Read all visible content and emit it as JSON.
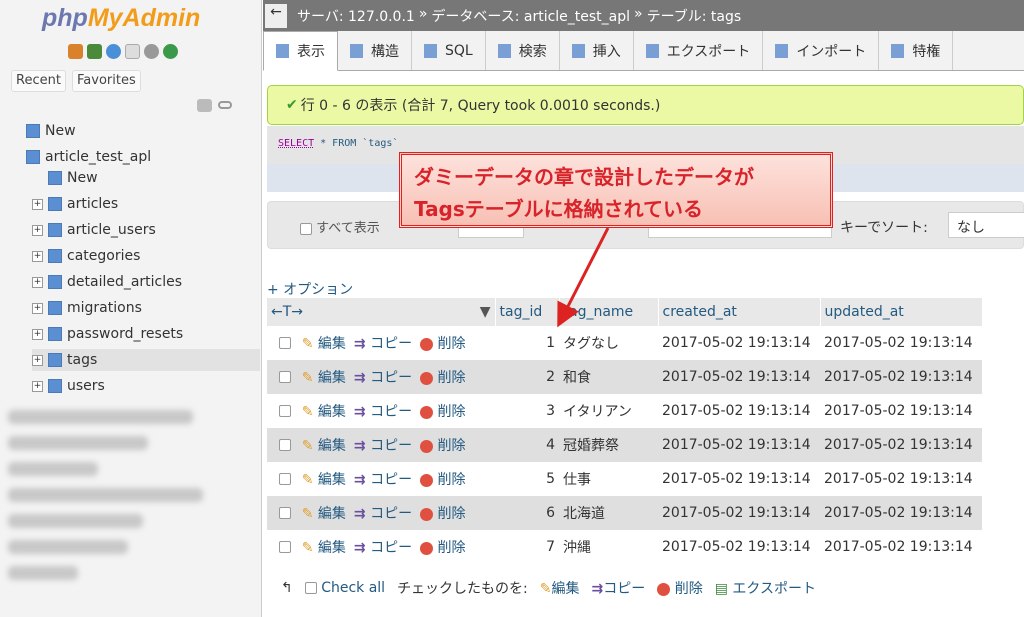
{
  "sidebar": {
    "logo_php": "php",
    "logo_myadmin": "MyAdmin",
    "recent": "Recent",
    "favorites": "Favorites",
    "tree": [
      {
        "label": "New",
        "level": 0
      },
      {
        "label": "article_test_apl",
        "level": 0
      },
      {
        "label": "New",
        "level": 1
      },
      {
        "label": "articles",
        "level": 1
      },
      {
        "label": "article_users",
        "level": 1
      },
      {
        "label": "categories",
        "level": 1
      },
      {
        "label": "detailed_articles",
        "level": 1
      },
      {
        "label": "migrations",
        "level": 1
      },
      {
        "label": "password_resets",
        "level": 1
      },
      {
        "label": "tags",
        "level": 1,
        "selected": true
      },
      {
        "label": "users",
        "level": 1
      }
    ]
  },
  "breadcrumb": {
    "back": "←",
    "server": "サーバ: 127.0.0.1",
    "sep": "»",
    "database": "データベース: article_test_apl",
    "table": "テーブル: tags"
  },
  "tabs": [
    "表示",
    "構造",
    "SQL",
    "検索",
    "挿入",
    "エクスポート",
    "インポート",
    "特権"
  ],
  "message": "行 0 - 6 の表示 (合計 7, Query took 0.0010 seconds.)",
  "query": {
    "k1": "SELECT",
    "rest": " * FROM `tags`"
  },
  "filter": {
    "show_all": "すべて表示",
    "sort_label": "キーでソート:",
    "sort_value": "なし"
  },
  "options": "+ オプション",
  "table": {
    "nav": "←T→",
    "columns": [
      "tag_id",
      "tag_name",
      "created_at",
      "updated_at"
    ],
    "actions": {
      "edit": "編集",
      "copy": "コピー",
      "delete": "削除"
    },
    "rows": [
      [
        "1",
        "タグなし",
        "2017-05-02 19:13:14",
        "2017-05-02 19:13:14"
      ],
      [
        "2",
        "和食",
        "2017-05-02 19:13:14",
        "2017-05-02 19:13:14"
      ],
      [
        "3",
        "イタリアン",
        "2017-05-02 19:13:14",
        "2017-05-02 19:13:14"
      ],
      [
        "4",
        "冠婚葬祭",
        "2017-05-02 19:13:14",
        "2017-05-02 19:13:14"
      ],
      [
        "5",
        "仕事",
        "2017-05-02 19:13:14",
        "2017-05-02 19:13:14"
      ],
      [
        "6",
        "北海道",
        "2017-05-02 19:13:14",
        "2017-05-02 19:13:14"
      ],
      [
        "7",
        "沖縄",
        "2017-05-02 19:13:14",
        "2017-05-02 19:13:14"
      ]
    ]
  },
  "footer": {
    "check_all": "Check all",
    "with_selected": "チェックしたものを:",
    "edit": "編集",
    "copy": "コピー",
    "delete": "削除",
    "export": "エクスポート"
  },
  "callout": {
    "line1": "ダミーデータの章で設計したデータが",
    "line2": "Tagsテーブルに格納されている",
    "color": "#d8232a"
  }
}
